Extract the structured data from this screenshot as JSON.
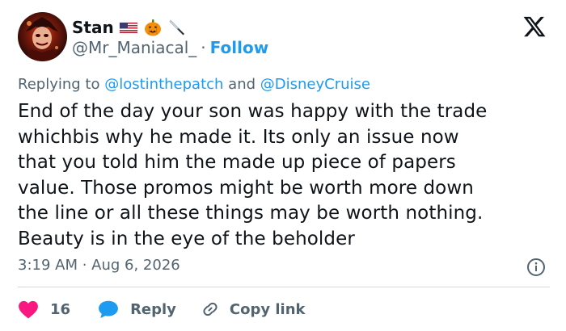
{
  "author": {
    "display_name": "Stan",
    "handle": "@Mr_Maniacal_",
    "separator": "·",
    "follow_label": "Follow"
  },
  "reply_context": {
    "prefix": "Replying to",
    "mention_1": "@lostinthepatch",
    "conjunction": "and",
    "mention_2": "@DisneyCruise"
  },
  "tweet": {
    "lines": [
      "End of the day your son was happy with the trade",
      "whichbis why he made it. Its only an issue now",
      "that you told him the made up piece of papers",
      "value. Those promos might be worth more down",
      "the line or all these things may be worth nothing.",
      "Beauty is in the eye of the beholder"
    ],
    "timestamp": "3:19 AM · Aug 6, 2026"
  },
  "actions": {
    "likes": "16",
    "reply_label": "Reply",
    "copy_link_label": "Copy link"
  },
  "colors": {
    "accent": "#1d9bf0",
    "secondary_text": "#536471",
    "like": "#f91880",
    "divider": "#cfd9de"
  }
}
